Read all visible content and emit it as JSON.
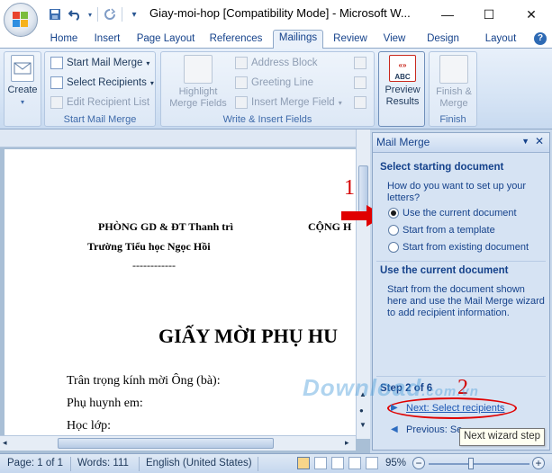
{
  "window": {
    "title": "Giay-moi-hop [Compatibility Mode] - Microsoft W...",
    "minimize": "—",
    "maximize": "☐",
    "close": "✕"
  },
  "quick_access": [
    "save-icon",
    "undo-icon",
    "redo-icon",
    "customize-icon"
  ],
  "ribbon": {
    "tabs": [
      "Home",
      "Insert",
      "Page Layout",
      "References",
      "Mailings",
      "Review",
      "View",
      "Design",
      "Layout"
    ],
    "active_tab": "Mailings",
    "groups": {
      "create": {
        "label": "",
        "button": "Create"
      },
      "start_mail_merge": {
        "label": "Start Mail Merge",
        "start_mail_merge": "Start Mail Merge",
        "select_recipients": "Select Recipients",
        "edit_recipient_list": "Edit Recipient List"
      },
      "write_insert": {
        "label": "Write & Insert Fields",
        "highlight_1": "Highlight",
        "highlight_2": "Merge Fields",
        "address_block": "Address Block",
        "greeting_line": "Greeting Line",
        "insert_merge_field": "Insert Merge Field"
      },
      "preview": {
        "label": "",
        "line1": "Preview",
        "line2": "Results",
        "abc_icon": "ABC"
      },
      "finish": {
        "label": "Finish",
        "line1": "Finish &",
        "line2": "Merge"
      }
    }
  },
  "document": {
    "line1_left": "PHÒNG GD & ĐT Thanh trì",
    "line1_right": "CỘNG H",
    "line2": "Trường Tiểu học Ngọc Hồi",
    "dashes": "------------",
    "heading": "GIẤY MỜI PHỤ HU",
    "body1": "Trân trọng kính mời Ông (bà):",
    "body2": "Phụ huynh em:",
    "body3": "Học lớp:"
  },
  "mail_merge_pane": {
    "title": "Mail Merge",
    "section1": "Select starting document",
    "question": "How do you want to set up your letters?",
    "options": [
      {
        "label": "Use the current document",
        "selected": true
      },
      {
        "label": "Start from a template",
        "selected": false
      },
      {
        "label": "Start from existing document",
        "selected": false
      }
    ],
    "section2": "Use the current document",
    "description": "Start from the document shown here and use the Mail Merge wizard to add recipient information.",
    "step": "Step 2 of 6",
    "next_link": "Next: Select recipients",
    "previous_link": "Previous: Se"
  },
  "annotations": {
    "num1": "1",
    "num2": "2"
  },
  "watermark": {
    "main": "Download",
    "suffix": ".com.vn"
  },
  "tooltip": "Next wizard step",
  "statusbar": {
    "page": "Page: 1 of 1",
    "words": "Words: 111",
    "language": "English (United States)",
    "zoom": "95%"
  },
  "colors": {
    "accent": "#15428b",
    "annotation_red": "#d40000",
    "ribbon_bg": "#dde8f6"
  }
}
